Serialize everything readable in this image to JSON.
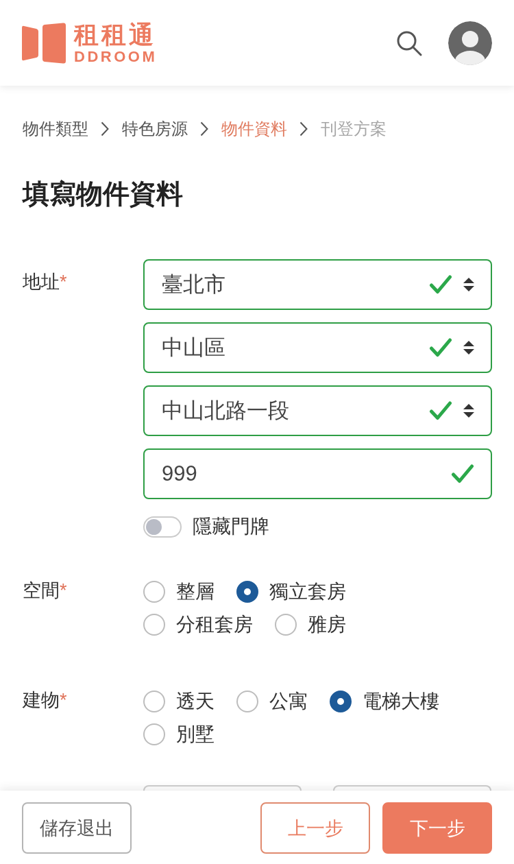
{
  "header": {
    "logo": {
      "title": "租租通",
      "subtitle": "DDROOM"
    }
  },
  "breadcrumb": [
    {
      "label": "物件類型",
      "selected": false,
      "disabled": false
    },
    {
      "label": "特色房源",
      "selected": false,
      "disabled": false
    },
    {
      "label": "物件資料",
      "selected": true,
      "disabled": false
    },
    {
      "label": "刊登方案",
      "selected": false,
      "disabled": true
    }
  ],
  "page_title": "填寫物件資料",
  "form": {
    "fields": [
      {
        "kind": "address",
        "label": "地址",
        "required_mark": "*",
        "inputs": [
          {
            "kind": "select",
            "value": "臺北市",
            "valid": true
          },
          {
            "kind": "select",
            "value": "中山區",
            "valid": true
          },
          {
            "kind": "select",
            "value": "中山北路一段",
            "valid": true
          },
          {
            "kind": "text",
            "value": "999",
            "valid": true
          }
        ],
        "toggle": {
          "label": "隱藏門牌",
          "on": false
        }
      },
      {
        "kind": "radio",
        "label": "空間",
        "required_mark": "*",
        "options": [
          {
            "label": "整層",
            "selected": false
          },
          {
            "label": "獨立套房",
            "selected": true
          },
          {
            "label": "分租套房",
            "selected": false
          },
          {
            "label": "雅房",
            "selected": false
          }
        ]
      },
      {
        "kind": "radio",
        "label": "建物",
        "required_mark": "*",
        "options": [
          {
            "label": "透天",
            "selected": false
          },
          {
            "label": "公寓",
            "selected": false
          },
          {
            "label": "電梯大樓",
            "selected": true
          },
          {
            "label": "別墅",
            "selected": false
          }
        ]
      }
    ],
    "cut_off_row": {
      "inputs": [
        {
          "kind": "field"
        },
        {
          "kind": "field"
        }
      ]
    }
  },
  "footer": {
    "buttons": [
      {
        "label": "儲存退出",
        "kind": "neutral"
      },
      {
        "label": "上一步",
        "kind": "outline"
      },
      {
        "label": "下一步",
        "kind": "primary"
      }
    ]
  }
}
